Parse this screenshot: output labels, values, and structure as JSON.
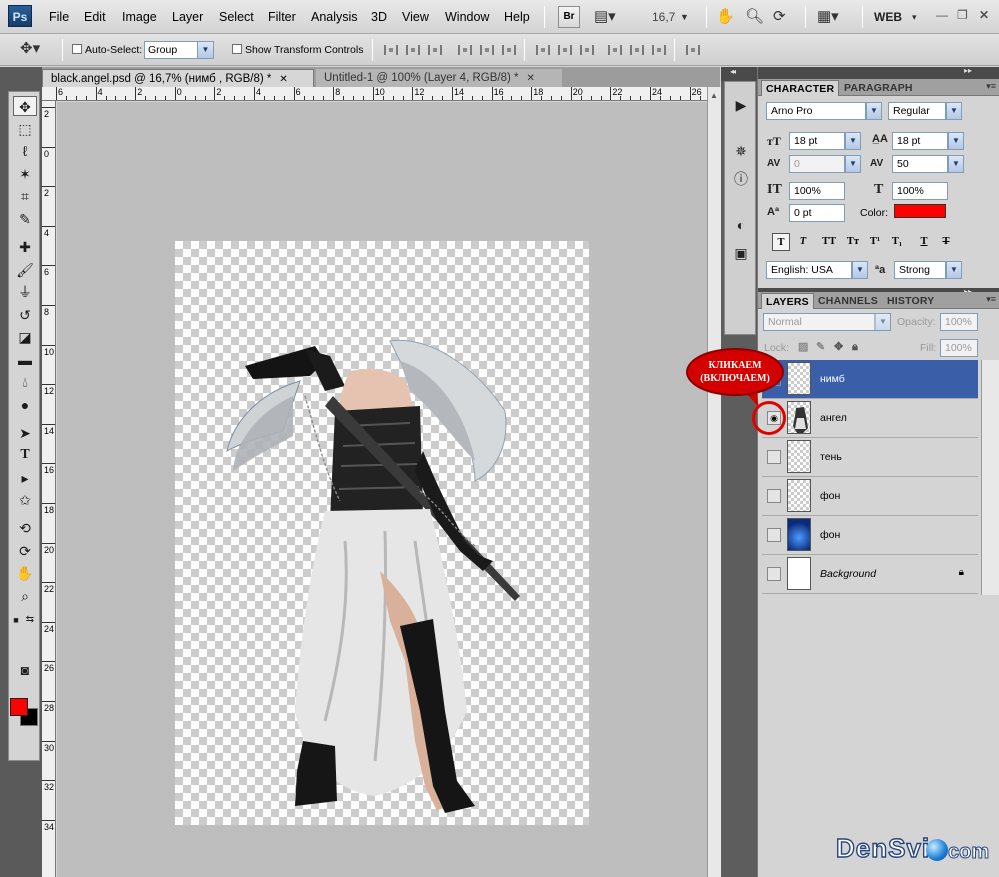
{
  "app": {
    "logo": "Ps"
  },
  "menu": [
    "File",
    "Edit",
    "Image",
    "Layer",
    "Select",
    "Filter",
    "Analysis",
    "3D",
    "View",
    "Window",
    "Help"
  ],
  "menubar": {
    "bridge_label": "Br",
    "zoom": "16,7",
    "workspace": "WEB"
  },
  "options": {
    "auto_select_label": "Auto-Select:",
    "auto_select_checked": false,
    "auto_select_value": "Group",
    "show_transform_label": "Show Transform Controls",
    "show_transform_checked": false
  },
  "tabs": [
    {
      "label": "black.angel.psd @ 16,7% (нимб , RGB/8) *",
      "active": true
    },
    {
      "label": "Untitled-1 @ 100% (Layer 4, RGB/8) *",
      "active": false
    }
  ],
  "ruler": {
    "top": [
      "6",
      "4",
      "2",
      "0",
      "2",
      "4",
      "6",
      "8",
      "10",
      "12",
      "14",
      "16",
      "18",
      "20",
      "22",
      "24",
      "26"
    ],
    "left": [
      "2",
      "0",
      "2",
      "4",
      "6",
      "8",
      "10",
      "12",
      "14",
      "16",
      "18",
      "20",
      "22",
      "24",
      "26",
      "28",
      "30",
      "32",
      "34"
    ]
  },
  "character": {
    "tab_character": "CHARACTER",
    "tab_paragraph": "PARAGRAPH",
    "font_family": "Arno Pro",
    "font_style": "Regular",
    "font_size": "18 pt",
    "leading": "18 pt",
    "kerning": "0",
    "tracking": "50",
    "vertical_scale": "100%",
    "horizontal_scale": "100%",
    "baseline_shift": "0 pt",
    "color_label": "Color:",
    "color": "#ff0000",
    "language": "English: USA",
    "aa_label": "a",
    "antialias": "Strong"
  },
  "layers_panel": {
    "tab_layers": "LAYERS",
    "tab_channels": "CHANNELS",
    "tab_history": "HISTORY",
    "blend_mode": "Normal",
    "opacity_label": "Opacity:",
    "opacity": "100%",
    "lock_label": "Lock:",
    "fill_label": "Fill:",
    "fill": "100%",
    "layers": [
      {
        "name": "нимб",
        "selected": true,
        "visible": false,
        "thumb": "checker"
      },
      {
        "name": "ангел",
        "selected": false,
        "visible": true,
        "thumb": "checker"
      },
      {
        "name": "тень",
        "selected": false,
        "visible": false,
        "thumb": "checker"
      },
      {
        "name": "фон",
        "selected": false,
        "visible": false,
        "thumb": "checker"
      },
      {
        "name": "фон",
        "selected": false,
        "visible": false,
        "thumb": "blue"
      },
      {
        "name": "Background",
        "selected": false,
        "visible": false,
        "thumb": "white",
        "locked": true
      }
    ]
  },
  "annotation": {
    "line1": "КЛИКАЕМ",
    "line2": "(ВКЛЮЧАЕМ)"
  },
  "watermark": {
    "brand": "DenSvi",
    "tld": "com"
  },
  "colors": {
    "foreground": "#ff0000",
    "background": "#000000",
    "selection": "#3a5fa8"
  }
}
